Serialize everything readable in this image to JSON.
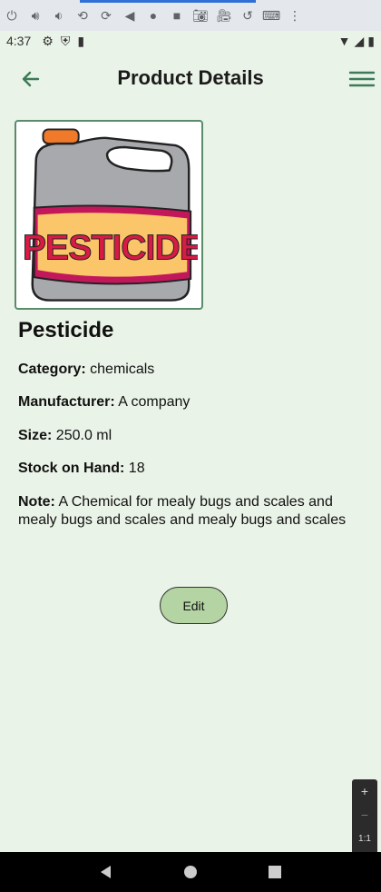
{
  "status_bar": {
    "time": "4:37"
  },
  "appbar": {
    "title": "Product Details"
  },
  "product": {
    "name": "Pesticide",
    "image_label": "PESTICIDE",
    "category_label": "Category:",
    "category": "chemicals",
    "manufacturer_label": "Manufacturer:",
    "manufacturer": "A company",
    "size_label": "Size:",
    "size": "250.0 ml",
    "stock_label": "Stock on Hand:",
    "stock": "18",
    "note_label": "Note:",
    "note": "A Chemical for mealy bugs and scales and mealy bugs and scales and mealy bugs and scales"
  },
  "actions": {
    "edit_label": "Edit"
  },
  "zoom_controls": {
    "zoom_in": "+",
    "zoom_out": "−",
    "ratio": "1:1"
  },
  "colors": {
    "background": "#eaf3e7",
    "accent": "#5b8c6a",
    "edit_button": "#b4d4a4"
  }
}
